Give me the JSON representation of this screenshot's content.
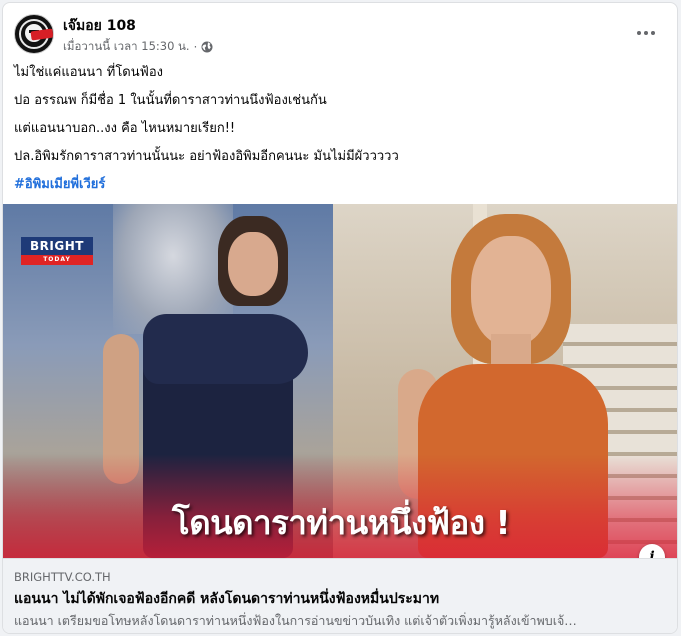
{
  "post": {
    "author": "เจ๊มอย 108",
    "timestamp": "เมื่อวานนี้ เวลา 15:30 น.",
    "separator": "·",
    "privacy_icon": "globe-icon",
    "more_icon": "more-horizontal-icon",
    "text_lines": [
      "ไม่ใช่แค่แอนนา ที่โดนฟ้อง",
      "ปอ อรรณพ ก็มีชื่อ 1 ในนั้นที่ดาราสาวท่านนึงฟ้องเช่นกัน",
      "แต่แอนนาบอก..งง คือ ไหนหมายเรียก!!",
      "ปล.อิพิมรักดาราสาวท่านนั้นนะ อย่าฟ้องอิพิมอีกคนนะ มันไม่มีผัววววว"
    ],
    "hashtag": "#อิพิมเมียพี่เวียร์"
  },
  "image": {
    "brand_logo_top": "BRIGHT",
    "brand_logo_bottom": "TODAY",
    "headline": "โดนดาราท่านหนึ่งฟ้อง !",
    "info_icon": "info-icon",
    "info_label": "i"
  },
  "link": {
    "domain": "BRIGHTTV.CO.TH",
    "title": "แอนนา ไม่ได้พักเจอฟ้องอีกคดี หลังโดนดาราท่านหนึ่งฟ้องหมื่นประมาท",
    "description": "แอนนา เตรียมขอโทษหลังโดนดาราท่านหนึ่งฟ้องในการอ่านขข่าวบันเทิง แต่เจ้าตัวเพิ่งมารู้หลังเข้าพบเจ้…"
  },
  "colors": {
    "hashtag": "#216fdb",
    "secondary_text": "#65676b",
    "link_bg": "#f0f2f5",
    "brand_blue": "#1e3a78",
    "brand_red": "#e02424"
  }
}
